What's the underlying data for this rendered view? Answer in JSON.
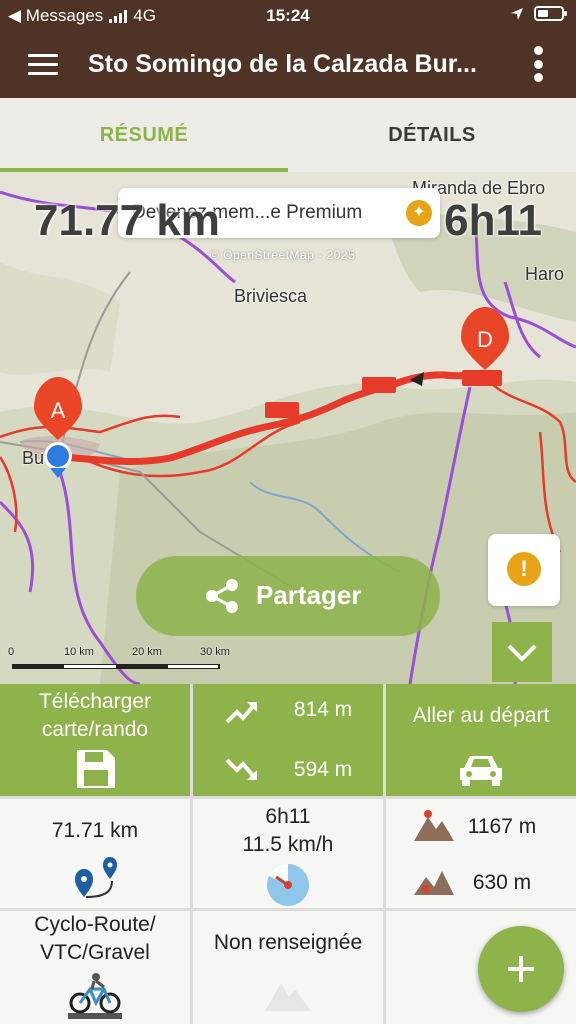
{
  "status_bar": {
    "back_app": "◀ Messages",
    "network": "4G",
    "time": "15:24"
  },
  "app_bar": {
    "title": "Sto Somingo de la Calzada Bur..."
  },
  "tabs": [
    {
      "label": "RÉSUMÉ",
      "active": true
    },
    {
      "label": "DÉTAILS",
      "active": false
    }
  ],
  "map": {
    "premium_banner": "Devenez mem...e Premium",
    "attribution": "© OpenStreetMap - 2025",
    "distance": "71.77 km",
    "duration": "6h11",
    "place_labels": [
      "Miranda de Ebro",
      "Haro",
      "Briviesca",
      "Burgos"
    ],
    "marker_start": "A",
    "marker_end": "D",
    "share_label": "Partager",
    "scale_ticks": [
      "0",
      "10 km",
      "20 km",
      "30 km"
    ],
    "route_color": "#e63a2a",
    "accent_color": "#8db34a"
  },
  "actions": {
    "download_label": "Télécharger carte/rando",
    "ascent": "814 m",
    "descent": "594 m",
    "go_to_start_label": "Aller au départ"
  },
  "stats": {
    "distance": "71.71 km",
    "time": "6h11",
    "speed": "11.5 km/h",
    "max_altitude": "1167 m",
    "min_altitude": "630 m",
    "activity": "Cyclo-Route/ VTC/Gravel",
    "difficulty": "Non renseignée"
  }
}
